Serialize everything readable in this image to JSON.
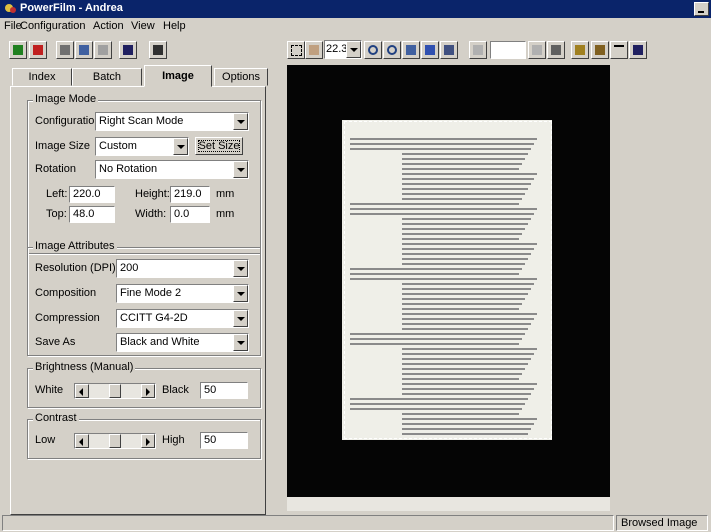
{
  "window": {
    "title": "PowerFilm - Andrea"
  },
  "menu": [
    "File",
    "Configuration",
    "Action",
    "View",
    "Help"
  ],
  "toolbar": {
    "zoom": "22.3%",
    "page_input": ""
  },
  "tabs": [
    "Index",
    "Batch",
    "Image",
    "Options"
  ],
  "active_tab": "Image",
  "image_mode": {
    "group_label": "Image Mode",
    "configuration_label": "Configuration",
    "configuration_value": "Right Scan Mode",
    "image_size_label": "Image Size",
    "image_size_value": "Custom",
    "set_size_button": "Set Size",
    "rotation_label": "Rotation",
    "rotation_value": "No Rotation",
    "left_label": "Left:",
    "left_value": "220.0",
    "height_label": "Height:",
    "height_value": "219.0",
    "top_label": "Top:",
    "top_value": "48.0",
    "width_label": "Width:",
    "width_value": "0.0",
    "unit": "mm"
  },
  "image_attributes": {
    "group_label": "Image Attributes",
    "resolution_label": "Resolution (DPI)",
    "resolution_value": "200",
    "composition_label": "Composition",
    "composition_value": "Fine Mode 2",
    "compression_label": "Compression",
    "compression_value": "CCITT G4-2D",
    "save_as_label": "Save As",
    "save_as_value": "Black and White"
  },
  "brightness": {
    "group_label": "Brightness (Manual)",
    "low_label": "White",
    "high_label": "Black",
    "value": "50"
  },
  "contrast": {
    "group_label": "Contrast",
    "low_label": "Low",
    "high_label": "High",
    "value": "50"
  },
  "status": {
    "main": "",
    "right": "Browsed Image"
  },
  "colors": {
    "titlebar": "#0a246a",
    "face": "#d4d0c8",
    "viewer_bg": "#050505"
  }
}
